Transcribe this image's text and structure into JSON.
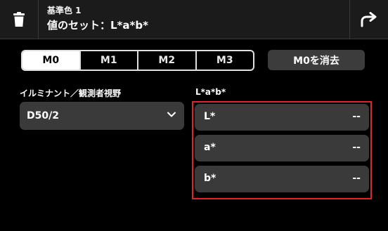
{
  "header": {
    "subtitle": "基準色 1",
    "title": "値のセット：L*a*b*",
    "left_icon": "trash-icon",
    "right_icon": "return-arrow-icon"
  },
  "memory_tabs": [
    {
      "label": "M0",
      "selected": true
    },
    {
      "label": "M1",
      "selected": false
    },
    {
      "label": "M2",
      "selected": false
    },
    {
      "label": "M3",
      "selected": false
    }
  ],
  "clear_button_label": "M0を消去",
  "illuminant": {
    "label": "イルミナント／観測者視野",
    "value": "D50/2",
    "icon": "chevron-down-icon"
  },
  "lab": {
    "label": "L*a*b*",
    "rows": [
      {
        "label": "L*",
        "value": "--"
      },
      {
        "label": "a*",
        "value": "--"
      },
      {
        "label": "b*",
        "value": "--"
      }
    ],
    "highlight_color": "#e0242a"
  },
  "colors": {
    "background": "#000000",
    "header_bg": "#1b1b1b",
    "field_bg": "#3a3a3a",
    "active_tab_bg": "#ffffff"
  }
}
